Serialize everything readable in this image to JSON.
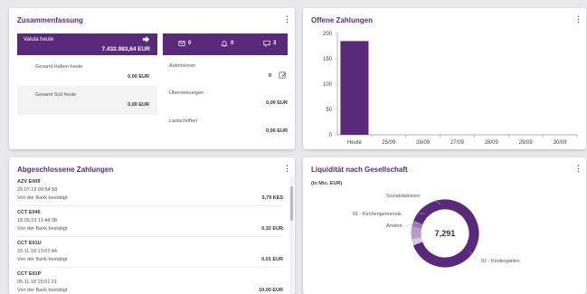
{
  "summary": {
    "title": "Zusammenfassung",
    "valuta_label": "Valuta heute",
    "valuta_amount": "7.432.983,64 EUR",
    "counts": [
      {
        "icon": "mail-icon",
        "value": "0"
      },
      {
        "icon": "bell-icon",
        "value": "0"
      },
      {
        "icon": "message-icon",
        "value": "3"
      }
    ],
    "haben_label": "Gesamt Haben heute",
    "haben_amount": "0,00 EUR",
    "soll_label": "Gesamt Soll heute",
    "soll_amount": "0,00 EUR",
    "autorisieren_label": "Autorisieren",
    "autorisieren_value": "0",
    "ueberweisungen_label": "Überweisungen",
    "ueberweisungen_amount": "0,00 EUR",
    "lastschriften_label": "Lastschriften",
    "lastschriften_amount": "0,00 EUR"
  },
  "open_payments": {
    "title": "Offene Zahlungen"
  },
  "chart_data": {
    "type": "bar",
    "categories": [
      "Heute",
      "25/09",
      "26/09",
      "27/09",
      "28/09",
      "29/09",
      "30/09"
    ],
    "values": [
      185,
      0,
      0,
      0,
      0,
      0,
      0
    ],
    "ylim": [
      0,
      200
    ],
    "yticks": [
      0,
      50,
      100,
      150,
      200
    ],
    "grid": false,
    "color": "#5a2a7a"
  },
  "completed": {
    "title": "Abgeschlossene Zahlungen",
    "items": [
      {
        "name": "AZV E009",
        "datetime": "29.07.19 09:54:58",
        "status": "Von der Bank bestätigt",
        "amount": "5,79 KES"
      },
      {
        "name": "CCT E046",
        "datetime": "18.06.19 11:44:38",
        "status": "Von der Bank bestätigt",
        "amount": "0,32 EUR"
      },
      {
        "name": "CCT E01U",
        "datetime": "15.11.18 13:07:44",
        "status": "Von der Bank bestätigt",
        "amount": "0,01 EUR"
      },
      {
        "name": "CCT E01P",
        "datetime": "05.11.18 15:01:21",
        "status": "Von der Bank bestätigt",
        "amount": "10,00 EUR"
      }
    ]
  },
  "liquidity": {
    "title": "Liquidität nach Gesellschaft",
    "unit": "(In Mio. EUR)",
    "total": "7,291",
    "segments": [
      {
        "label": "02 - Kindergärten",
        "value": 0.88,
        "color": "#5a2a7a"
      },
      {
        "label": "Sozialstationen",
        "value": 0.03,
        "color": "#d9c9e3"
      },
      {
        "label": "01 - Kirchengemeinde",
        "value": 0.06,
        "color": "#b79bc8"
      },
      {
        "label": "Andere",
        "value": 0.03,
        "color": "#9a78b3"
      }
    ]
  },
  "colors": {
    "accent": "#5a2a7a"
  }
}
